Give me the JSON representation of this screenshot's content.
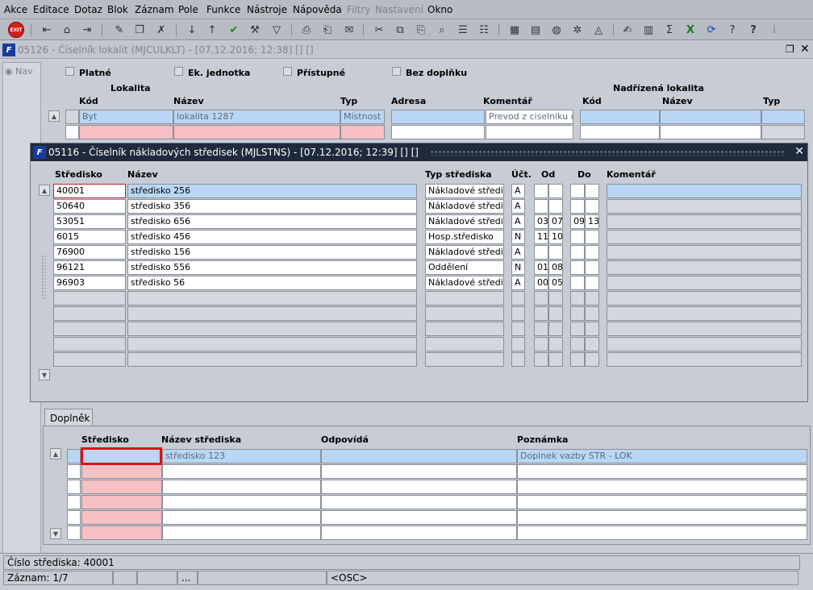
{
  "menu": [
    "Akce",
    "Editace",
    "Dotaz",
    "Blok",
    "Záznam",
    "Pole",
    "Funkce",
    "Nástroje",
    "Nápověda",
    "Filtry",
    "Nastavení",
    "Okno"
  ],
  "main_window": {
    "title": "05126 - Číselník lokalit (MJCULKLT) - [07.12.2016; 12:38] [] []",
    "nav_label": "Nav",
    "checkboxes": [
      "Platné",
      "Ek. jednotka",
      "Přístupné",
      "Bez doplňku"
    ],
    "group_lokalita": "Lokalita",
    "group_nadrizena": "Nadřízená lokalita",
    "headers": {
      "kod": "Kód",
      "nazev": "Název",
      "typ": "Typ",
      "adresa": "Adresa",
      "komentar": "Komentář",
      "n_kod": "Kód",
      "n_nazev": "Název",
      "n_typ": "Typ"
    },
    "row1": {
      "kod": "Byt",
      "nazev": "lokalita 1287",
      "typ": "Místnost",
      "komentar": "Prevod z ciselniku um"
    }
  },
  "dialog": {
    "title": "05116 - Číselník nákladových středisek (MJLSTNS) - [07.12.2016; 12:39] [] []",
    "headers": {
      "stredisko": "Středisko",
      "nazev": "Název",
      "typ": "Typ střediska",
      "uct": "Účt.",
      "od": "Od",
      "do": "Do",
      "komentar": "Komentář"
    },
    "rows": [
      {
        "stredisko": "40001",
        "nazev": "středisko 256",
        "typ": "Nákladové středisk",
        "uct": "A",
        "od1": "",
        "od2": "",
        "do1": "",
        "do2": ""
      },
      {
        "stredisko": "50640",
        "nazev": "středisko 356",
        "typ": "Nákladové středisk",
        "uct": "A",
        "od1": "",
        "od2": "",
        "do1": "",
        "do2": ""
      },
      {
        "stredisko": "53051",
        "nazev": "středisko 656",
        "typ": "Nákladové středisk",
        "uct": "A",
        "od1": "03",
        "od2": "07",
        "do1": "09",
        "do2": "13"
      },
      {
        "stredisko": "6015",
        "nazev": "středisko 456",
        "typ": "Hosp.středisko",
        "uct": "N",
        "od1": "11",
        "od2": "10",
        "do1": "",
        "do2": ""
      },
      {
        "stredisko": "76900",
        "nazev": "středisko 156",
        "typ": "Nákladové středisk",
        "uct": "A",
        "od1": "",
        "od2": "",
        "do1": "",
        "do2": ""
      },
      {
        "stredisko": "96121",
        "nazev": "středisko 556",
        "typ": "Oddělení",
        "uct": "N",
        "od1": "01",
        "od2": "08",
        "do1": "",
        "do2": ""
      },
      {
        "stredisko": "96903",
        "nazev": "středisko 56",
        "typ": "Nákladové středisk",
        "uct": "A",
        "od1": "00",
        "od2": "05",
        "do1": "",
        "do2": ""
      }
    ]
  },
  "doplnek": {
    "tab_label": "Doplněk",
    "headers": {
      "stredisko": "Středisko",
      "nazev": "Název střediska",
      "odpovida": "Odpovídá",
      "poznamka": "Poznámka"
    },
    "row1": {
      "stredisko": "",
      "nazev": "středisko 123",
      "odpovida": "",
      "poznamka": "Doplnek vazby STR - LOK"
    }
  },
  "status": {
    "line1": "Číslo střediska: 40001",
    "zaznam": "Záznam: 1/7",
    "dots": "...",
    "osc": "<OSC>"
  },
  "colors": {
    "selected": "#b9d7f4",
    "required": "#f6c0c4",
    "dialog_title": "#1f2a3c"
  }
}
